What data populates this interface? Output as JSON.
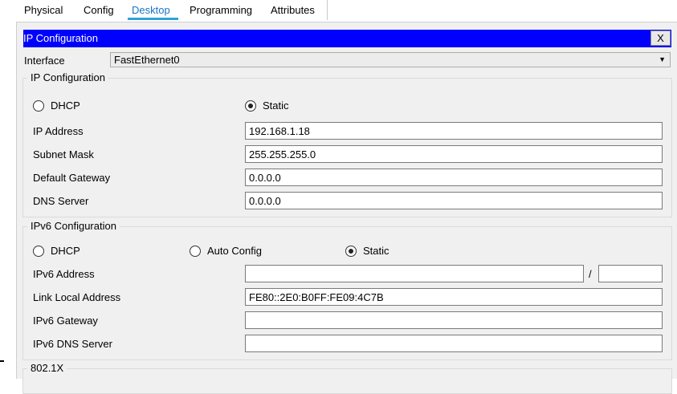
{
  "tabs": [
    {
      "label": "Physical"
    },
    {
      "label": "Config"
    },
    {
      "label": "Desktop"
    },
    {
      "label": "Programming"
    },
    {
      "label": "Attributes"
    }
  ],
  "active_tab": "Desktop",
  "window": {
    "title": "IP Configuration",
    "close_label": "X",
    "title_bar_color": "#0000ff"
  },
  "interface": {
    "label": "Interface",
    "selected": "FastEthernet0",
    "arrow": "▼"
  },
  "ipv4": {
    "legend": "IP Configuration",
    "dhcp_label": "DHCP",
    "static_label": "Static",
    "selected_mode": "Static",
    "ip_address_label": "IP Address",
    "ip_address_value": "192.168.1.18",
    "subnet_mask_label": "Subnet Mask",
    "subnet_mask_value": "255.255.255.0",
    "default_gateway_label": "Default Gateway",
    "default_gateway_value": "0.0.0.0",
    "dns_server_label": "DNS Server",
    "dns_server_value": "0.0.0.0"
  },
  "ipv6": {
    "legend": "IPv6 Configuration",
    "dhcp_label": "DHCP",
    "auto_config_label": "Auto Config",
    "static_label": "Static",
    "selected_mode": "Static",
    "ipv6_address_label": "IPv6 Address",
    "ipv6_address_value": "",
    "prefix_separator": "/",
    "prefix_value": "",
    "link_local_label": "Link Local Address",
    "link_local_value": "FE80::2E0:B0FF:FE09:4C7B",
    "gateway_label": "IPv6 Gateway",
    "gateway_value": "",
    "dns_label": "IPv6 DNS Server",
    "dns_value": ""
  },
  "dot1x": {
    "legend": "802.1X"
  }
}
